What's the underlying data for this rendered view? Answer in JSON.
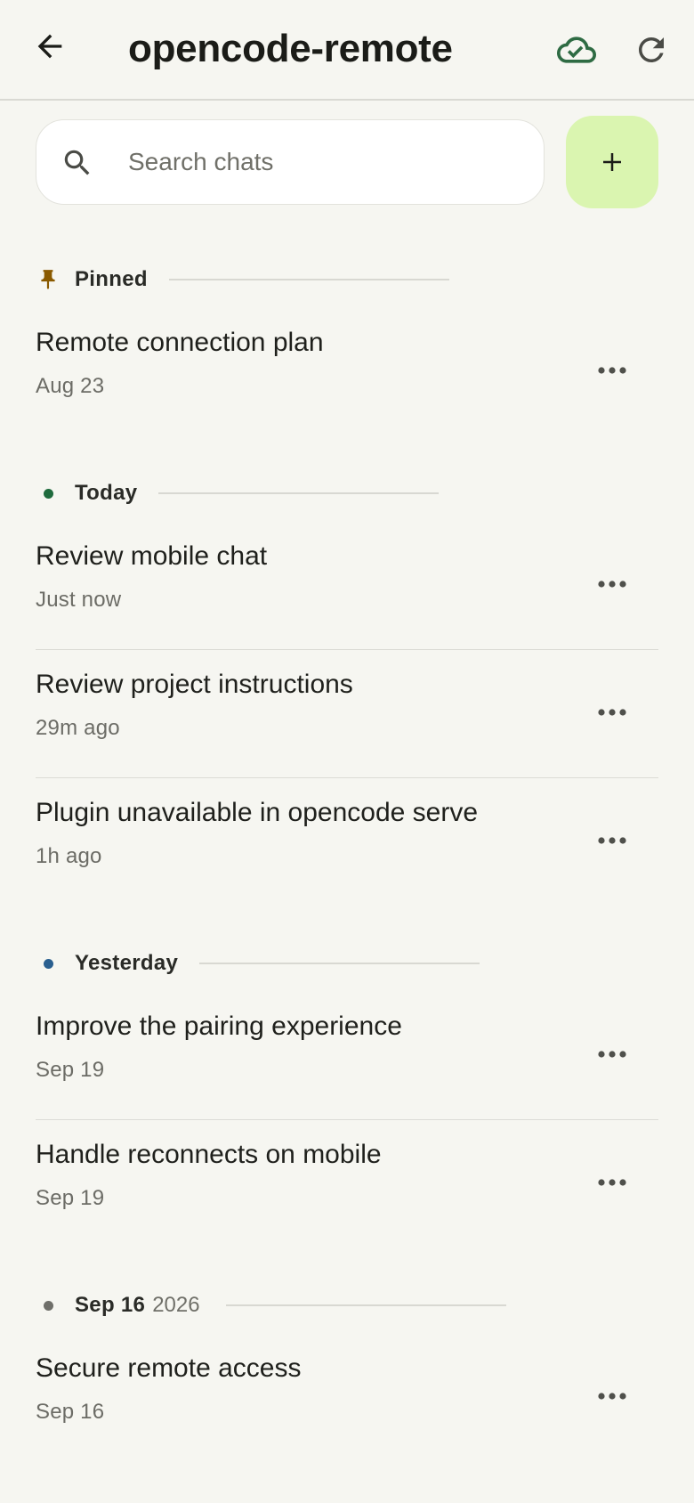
{
  "header": {
    "title": "opencode-remote",
    "back_icon": "arrow-left-icon",
    "sync_icon": "cloud-check-icon",
    "refresh_icon": "refresh-icon"
  },
  "search": {
    "placeholder": "Search chats",
    "value": "",
    "icon": "search-icon"
  },
  "new_chat_button": {
    "icon": "plus-icon"
  },
  "colors": {
    "background": "#f6f6f1",
    "accent_new_button": "#daf5b0",
    "pin": "#8a5a00",
    "today_dot": "#1f6b3d",
    "yesterday_dot": "#2a5f8f",
    "older_dot": "#6f6f6a",
    "cloud_ok": "#2e6b43"
  },
  "sections": [
    {
      "label": "Pinned",
      "sub": "",
      "icon": "pin-icon",
      "chats": [
        {
          "title": "Remote connection plan",
          "time": "Aug 23"
        }
      ]
    },
    {
      "label": "Today",
      "sub": "",
      "icon": "green-dot",
      "chats": [
        {
          "title": "Review mobile chat",
          "time": "Just now"
        },
        {
          "title": "Review project instructions",
          "time": "29m ago"
        },
        {
          "title": "Plugin unavailable in opencode serve",
          "time": "1h ago"
        }
      ]
    },
    {
      "label": "Yesterday",
      "sub": "",
      "icon": "blue-dot",
      "chats": [
        {
          "title": "Improve the pairing experience",
          "time": "Sep 19"
        },
        {
          "title": "Handle reconnects on mobile",
          "time": "Sep 19"
        }
      ]
    },
    {
      "label": "Sep 16",
      "sub": "2026",
      "icon": "gray-dot",
      "chats": [
        {
          "title": "Secure remote access",
          "time": "Sep 16"
        }
      ]
    }
  ]
}
